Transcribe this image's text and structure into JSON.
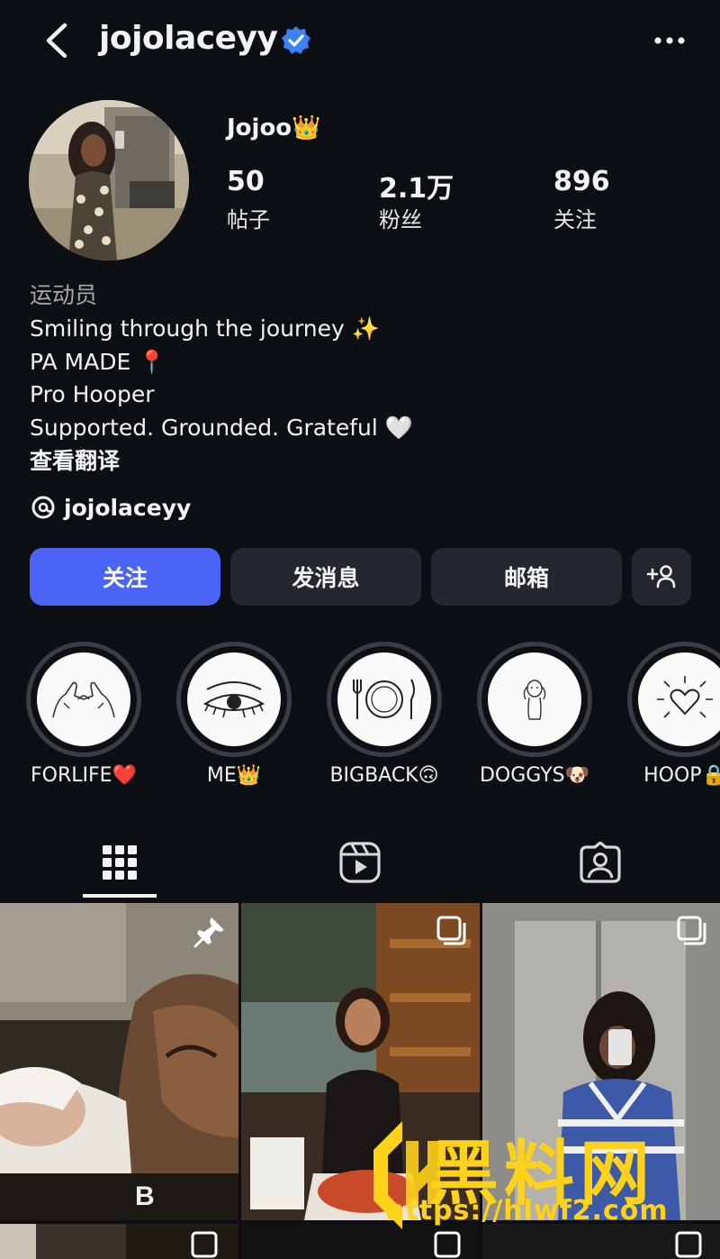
{
  "header": {
    "username": "jojolaceyy"
  },
  "profile": {
    "display_name": "Jojoo👑",
    "stats": [
      {
        "value": "50",
        "label": "帖子"
      },
      {
        "value": "2.1万",
        "label": "粉丝"
      },
      {
        "value": "896",
        "label": "关注"
      }
    ],
    "category": "运动员",
    "bio_lines": [
      "Smiling through the journey ✨",
      "PA MADE 📍",
      "Pro Hooper",
      "Supported. Grounded. Grateful 🤍"
    ],
    "see_translation": "查看翻译",
    "threads_handle": "jojolaceyy"
  },
  "buttons": {
    "follow": "关注",
    "message": "发消息",
    "email": "邮箱"
  },
  "highlights": [
    {
      "label": "FORLIFE❤️",
      "icon": "pinky-promise-icon"
    },
    {
      "label": "ME👑",
      "icon": "eye-lashes-icon"
    },
    {
      "label": "BIGBACK🙃",
      "icon": "plate-fork-knife-icon"
    },
    {
      "label": "DOGGYS🐶",
      "icon": "dog-icon"
    },
    {
      "label": "HOOP🔒",
      "icon": "heart-rays-icon"
    }
  ],
  "tabs": [
    {
      "name": "posts-grid",
      "icon": "grid-icon",
      "active": true
    },
    {
      "name": "reels",
      "icon": "reels-icon",
      "active": false
    },
    {
      "name": "tagged",
      "icon": "tagged-person-icon",
      "active": false
    }
  ],
  "watermark": {
    "text": "黑料网",
    "url": "https://hlwf2.com"
  },
  "colors": {
    "background": "#0c0f14",
    "follow_button": "#4a64f5",
    "secondary_button": "#24272e",
    "verified_badge": "#3b82f6",
    "watermark": "#ffd21a"
  }
}
